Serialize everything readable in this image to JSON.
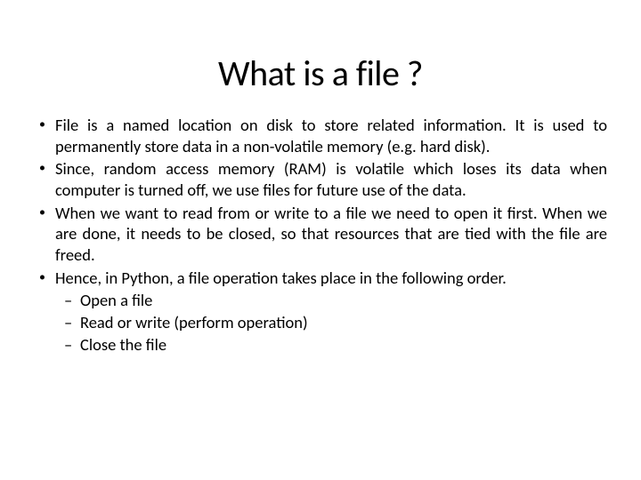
{
  "title": "What is a file ?",
  "bullets": [
    {
      "text": "File is a named location on disk to store related information. It is used to permanently store data in a non-volatile memory (e.g. hard disk)."
    },
    {
      "text": "Since, random access memory (RAM) is volatile which loses its data when computer is turned off, we use files for future use of the data."
    },
    {
      "text": "When we want to read from or write to a file we need to open it first. When we are done, it needs to be closed, so that resources that are tied with the file are freed."
    },
    {
      "text": "Hence, in Python, a file operation takes place in the following order.",
      "sub": [
        "Open a file",
        "Read or write (perform operation)",
        "Close the file"
      ]
    }
  ]
}
